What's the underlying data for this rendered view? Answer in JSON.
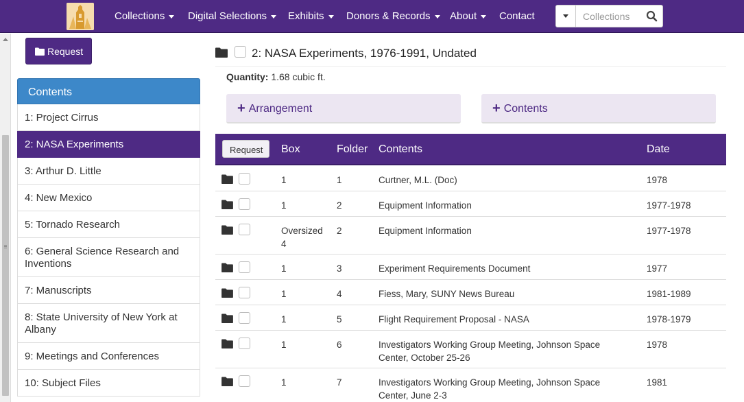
{
  "navbar": {
    "logo_icon": "tower-logo-icon",
    "items": [
      {
        "label": "Collections",
        "dropdown": true
      },
      {
        "label": "Digital Selections",
        "dropdown": true
      },
      {
        "label": "Exhibits",
        "dropdown": true
      },
      {
        "label": "Donors & Records",
        "dropdown": true
      },
      {
        "label": "About",
        "dropdown": true
      },
      {
        "label": "Contact",
        "dropdown": false
      }
    ],
    "search": {
      "placeholder": "Collections",
      "icon": "search-icon"
    }
  },
  "sidebar": {
    "request_label": "Request",
    "contents_heading": "Contents",
    "items": [
      {
        "label": "1: Project Cirrus",
        "active": false
      },
      {
        "label": "2: NASA Experiments",
        "active": true
      },
      {
        "label": "3: Arthur D. Little",
        "active": false
      },
      {
        "label": "4: New Mexico",
        "active": false
      },
      {
        "label": "5: Tornado Research",
        "active": false
      },
      {
        "label": "6: General Science Research and Inventions",
        "active": false
      },
      {
        "label": "7: Manuscripts",
        "active": false
      },
      {
        "label": "8: State University of New York at Albany",
        "active": false
      },
      {
        "label": "9: Meetings and Conferences",
        "active": false
      },
      {
        "label": "10: Subject Files",
        "active": false
      }
    ]
  },
  "main": {
    "title": "2: NASA Experiments, 1976-1991, Undated",
    "quantity_label": "Quantity:",
    "quantity_value": "1.68 cubic ft.",
    "arrangement_label": "Arrangement",
    "contents_label": "Contents"
  },
  "table": {
    "request_label": "Request",
    "headers": {
      "box": "Box",
      "folder": "Folder",
      "contents": "Contents",
      "date": "Date"
    },
    "rows": [
      {
        "box": "1",
        "folder": "1",
        "contents": "Curtner, M.L. (Doc)",
        "date": "1978"
      },
      {
        "box": "1",
        "folder": "2",
        "contents": "Equipment Information",
        "date": "1977-1978"
      },
      {
        "box": "Oversized 4",
        "folder": "2",
        "contents": "Equipment Information",
        "date": "1977-1978"
      },
      {
        "box": "1",
        "folder": "3",
        "contents": "Experiment Requirements Document",
        "date": "1977"
      },
      {
        "box": "1",
        "folder": "4",
        "contents": "Fiess, Mary, SUNY News Bureau",
        "date": "1981-1989"
      },
      {
        "box": "1",
        "folder": "5",
        "contents": "Flight Requirement Proposal - NASA",
        "date": "1978-1979"
      },
      {
        "box": "1",
        "folder": "6",
        "contents": "Investigators Working Group Meeting, Johnson Space Center, October 25-26",
        "date": "1978"
      },
      {
        "box": "1",
        "folder": "7",
        "contents": "Investigators Working Group Meeting, Johnson Space Center, June 2-3",
        "date": "1981"
      }
    ]
  },
  "colors": {
    "brand_purple": "#4e2a84",
    "contents_blue": "#3d88c9",
    "panel_lavender": "#ece6f2"
  }
}
